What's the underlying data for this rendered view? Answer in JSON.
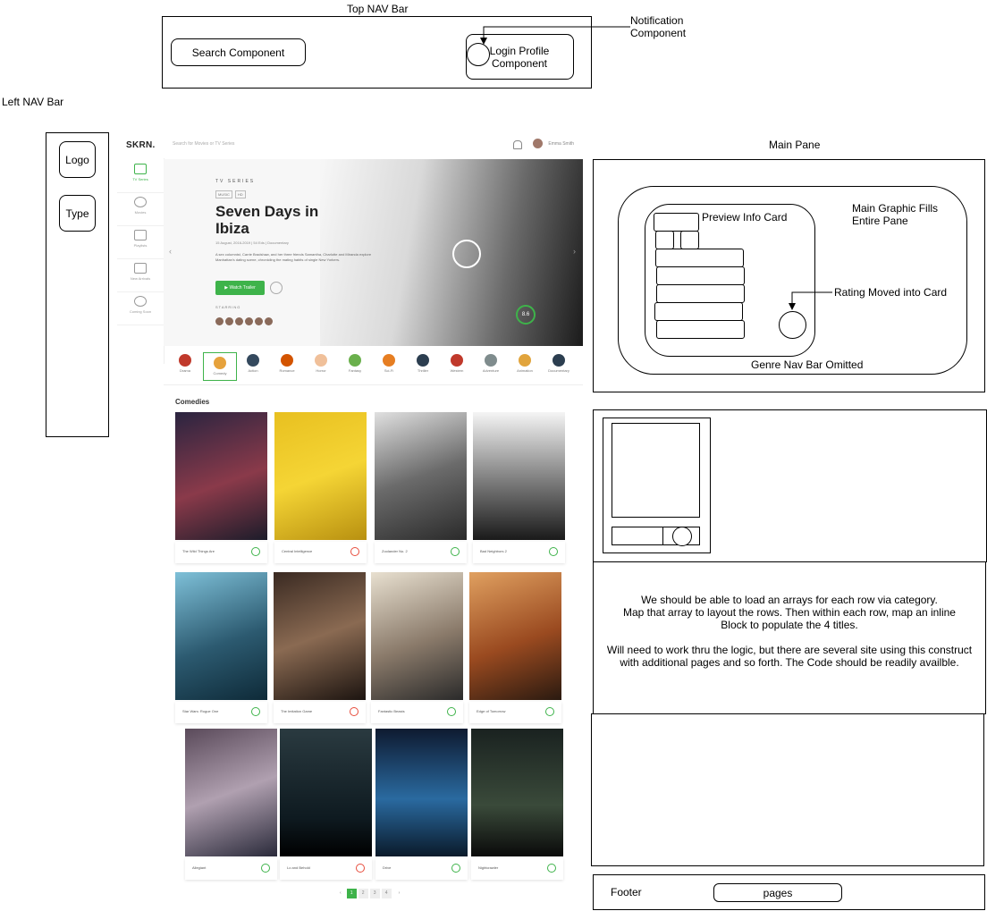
{
  "top_nav": {
    "title": "Top NAV Bar",
    "search": "Search Component",
    "login": "Login Profile Component",
    "notification": "Notification Component"
  },
  "left_nav": {
    "title": "Left NAV Bar",
    "logo": "Logo",
    "type": "Type"
  },
  "main_pane": {
    "title": "Main Pane",
    "preview_card": "Preview Info Card",
    "main_graphic": "Main Graphic Fills Entire Pane",
    "rating_note": "Rating Moved into Card",
    "genre_note": "Genre Nav Bar Omitted"
  },
  "notes": {
    "line1": "We should be able to load an arrays for each row via category.",
    "line2": "Map that array to layout the rows.  Then within each row, map an inline",
    "line3": "Block to populate the 4 titles.",
    "line4": "Will need to work thru the logic, but there are several site using this construct",
    "line5": "with additional pages and so forth.  The Code should be readily availble."
  },
  "footer": {
    "label": "Footer",
    "pages": "pages"
  },
  "screenshot": {
    "logo": "SKRN.",
    "nav": [
      {
        "label": "TV Series",
        "icon": "tv-icon"
      },
      {
        "label": "Movies",
        "icon": "film-reel-icon"
      },
      {
        "label": "Playlists",
        "icon": "playlist-icon"
      },
      {
        "label": "New Arrivals",
        "icon": "ticket-icon"
      },
      {
        "label": "Coming Soon",
        "icon": "alarm-clock-icon"
      }
    ],
    "search_placeholder": "Search for Movies or TV Series",
    "user_name": "Emma Smith",
    "hero": {
      "kicker": "TV SERIES",
      "tag1": "MUSIC",
      "tag2": "HD",
      "title": "Seven Days in Ibiza",
      "meta": "15 August, 2016-2019  |  54 Eds  |  Documentary",
      "description": "A sex columnist, Carrie Bradshaw, and her three friends Samantha, Charlotte and Miranda explore Manhattan's dating scene, chronicling the mating habits of single New Yorkers.",
      "watch_button": "Watch Trailer",
      "starring": "STARRING",
      "rating": "8.6"
    },
    "genres": [
      "Drama",
      "Comedy",
      "Action",
      "Romance",
      "Horror",
      "Fantasy",
      "Sci-Fi",
      "Thriller",
      "Western",
      "Adventure",
      "Animation",
      "Documentary"
    ],
    "category": "Comedies",
    "titles": [
      "The Wild Things Are",
      "Central Intelligence",
      "Zoolander No. 2",
      "Bad Neighbors 2",
      "Star Wars: Rogue One",
      "The Imitation Game",
      "Fantastic Beasts",
      "Edge of Tomorrow",
      "Allegiant",
      "Lo and Behold",
      "Drive",
      "Nightcrawler"
    ],
    "pages": [
      "1",
      "2",
      "3",
      "4"
    ]
  }
}
